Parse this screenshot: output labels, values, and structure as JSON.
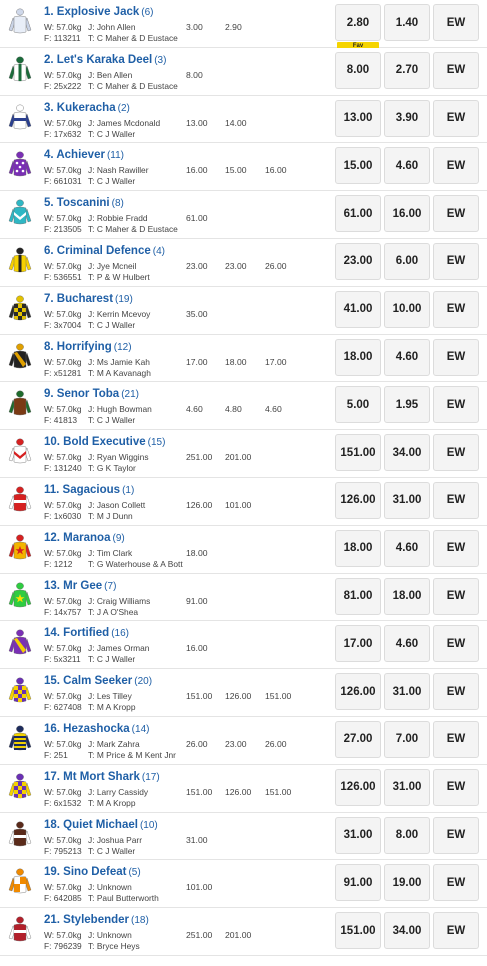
{
  "fav_label": "Fav",
  "ew_label": "EW",
  "runners": [
    {
      "no": "1",
      "name": "Explosive Jack",
      "barrier": "(6)",
      "weight": "W: 57.0kg",
      "jockey": "J: John Allen",
      "form": "F: 113211",
      "trainer": "T: C Maher & D Eustace",
      "hist": [
        "3.00",
        "2.90",
        ""
      ],
      "win": "2.80",
      "place": "1.40",
      "fav": true,
      "silk": {
        "body": "#e8eef8",
        "sleeve": "#c9d3e6",
        "cap": "#cfd8ea",
        "pattern": "none",
        "accent": "#9aa7c4"
      }
    },
    {
      "no": "2",
      "name": "Let's Karaka Deel",
      "barrier": "(3)",
      "weight": "W: 57.0kg",
      "jockey": "J: Ben Allen",
      "form": "F: 25x222",
      "trainer": "T: C Maher & D Eustace",
      "hist": [
        "8.00",
        "",
        ""
      ],
      "win": "8.00",
      "place": "2.70",
      "fav": false,
      "silk": {
        "body": "#ffffff",
        "sleeve": "#1a6b3a",
        "cap": "#1a6b3a",
        "pattern": "stripe",
        "accent": "#1a6b3a"
      }
    },
    {
      "no": "3",
      "name": "Kukeracha",
      "barrier": "(2)",
      "weight": "W: 57.0kg",
      "jockey": "J: James Mcdonald",
      "form": "F: 17x632",
      "trainer": "T: C J Waller",
      "hist": [
        "13.00",
        "14.00",
        ""
      ],
      "win": "13.00",
      "place": "3.90",
      "fav": false,
      "silk": {
        "body": "#ffffff",
        "sleeve": "#2a3f8f",
        "cap": "#ffffff",
        "pattern": "band",
        "accent": "#2a3f8f"
      }
    },
    {
      "no": "4",
      "name": "Achiever",
      "barrier": "(11)",
      "weight": "W: 57.0kg",
      "jockey": "J: Nash Rawiller",
      "form": "F: 661031",
      "trainer": "T: C J Waller",
      "hist": [
        "16.00",
        "15.00",
        "16.00"
      ],
      "win": "15.00",
      "place": "4.60",
      "fav": false,
      "silk": {
        "body": "#7a2fb5",
        "sleeve": "#7a2fb5",
        "cap": "#7a2fb5",
        "pattern": "spots",
        "accent": "#ffffff"
      }
    },
    {
      "no": "5",
      "name": "Toscanini",
      "barrier": "(8)",
      "weight": "W: 57.0kg",
      "jockey": "J: Robbie Fradd",
      "form": "F: 213505",
      "trainer": "T: C Maher & D Eustace",
      "hist": [
        "61.00",
        "",
        ""
      ],
      "win": "61.00",
      "place": "16.00",
      "fav": false,
      "silk": {
        "body": "#2fb7c4",
        "sleeve": "#2fb7c4",
        "cap": "#2fb7c4",
        "pattern": "chevron",
        "accent": "#ffffff"
      }
    },
    {
      "no": "6",
      "name": "Criminal Defence",
      "barrier": "(4)",
      "weight": "W: 57.0kg",
      "jockey": "J: Jye Mcneil",
      "form": "F: 536551",
      "trainer": "T: P & W Hulbert",
      "hist": [
        "23.00",
        "23.00",
        "26.00"
      ],
      "win": "23.00",
      "place": "6.00",
      "fav": false,
      "silk": {
        "body": "#f5d100",
        "sleeve": "#f5d100",
        "cap": "#222222",
        "pattern": "stripe",
        "accent": "#222222"
      }
    },
    {
      "no": "7",
      "name": "Bucharest",
      "barrier": "(19)",
      "weight": "W: 57.0kg",
      "jockey": "J: Kerrin Mcevoy",
      "form": "F: 3x7004",
      "trainer": "T: C J Waller",
      "hist": [
        "35.00",
        "",
        ""
      ],
      "win": "41.00",
      "place": "10.00",
      "fav": false,
      "silk": {
        "body": "#e3c200",
        "sleeve": "#2a2a2a",
        "cap": "#e3c200",
        "pattern": "check",
        "accent": "#2a2a2a"
      }
    },
    {
      "no": "8",
      "name": "Horrifying",
      "barrier": "(12)",
      "weight": "W: 57.0kg",
      "jockey": "J: Ms Jamie Kah",
      "form": "F: x51281",
      "trainer": "T: M A Kavanagh",
      "hist": [
        "17.00",
        "18.00",
        "17.00"
      ],
      "win": "18.00",
      "place": "4.60",
      "fav": false,
      "silk": {
        "body": "#222222",
        "sleeve": "#222222",
        "cap": "#e0a000",
        "pattern": "sash",
        "accent": "#e0a000"
      }
    },
    {
      "no": "9",
      "name": "Senor Toba",
      "barrier": "(21)",
      "weight": "W: 57.0kg",
      "jockey": "J: Hugh Bowman",
      "form": "F: 41813",
      "trainer": "T: C J Waller",
      "hist": [
        "4.60",
        "4.80",
        "4.60"
      ],
      "win": "5.00",
      "place": "1.95",
      "fav": false,
      "silk": {
        "body": "#7a3a14",
        "sleeve": "#1f6b2c",
        "cap": "#1f6b2c",
        "pattern": "none",
        "accent": "#1f6b2c"
      }
    },
    {
      "no": "10",
      "name": "Bold Executive",
      "barrier": "(15)",
      "weight": "W: 57.0kg",
      "jockey": "J: Ryan Wiggins",
      "form": "F: 131240",
      "trainer": "T: G K Taylor",
      "hist": [
        "251.00",
        "201.00",
        ""
      ],
      "win": "151.00",
      "place": "34.00",
      "fav": false,
      "silk": {
        "body": "#ffffff",
        "sleeve": "#ffffff",
        "cap": "#d62020",
        "pattern": "chevron",
        "accent": "#d62020"
      }
    },
    {
      "no": "11",
      "name": "Sagacious",
      "barrier": "(1)",
      "weight": "W: 57.0kg",
      "jockey": "J: Jason Collett",
      "form": "F: 1x6030",
      "trainer": "T: M J Dunn",
      "hist": [
        "126.00",
        "101.00",
        ""
      ],
      "win": "126.00",
      "place": "31.00",
      "fav": false,
      "silk": {
        "body": "#d62020",
        "sleeve": "#ffffff",
        "cap": "#d62020",
        "pattern": "band",
        "accent": "#ffffff"
      }
    },
    {
      "no": "12",
      "name": "Maranoa",
      "barrier": "(9)",
      "weight": "W: 57.0kg",
      "jockey": "J: Tim Clark",
      "form": "F: 1212",
      "trainer": "T: G Waterhouse & A Bott",
      "hist": [
        "18.00",
        "",
        ""
      ],
      "win": "18.00",
      "place": "4.60",
      "fav": false,
      "silk": {
        "body": "#f3b400",
        "sleeve": "#d62020",
        "cap": "#d62020",
        "pattern": "star",
        "accent": "#d62020"
      }
    },
    {
      "no": "13",
      "name": "Mr Gee",
      "barrier": "(7)",
      "weight": "W: 57.0kg",
      "jockey": "J: Craig Williams",
      "form": "F: 14x757",
      "trainer": "T: J A O'Shea",
      "hist": [
        "91.00",
        "",
        ""
      ],
      "win": "81.00",
      "place": "18.00",
      "fav": false,
      "silk": {
        "body": "#2ecc40",
        "sleeve": "#2ecc40",
        "cap": "#2ecc40",
        "pattern": "star",
        "accent": "#f5e000"
      }
    },
    {
      "no": "14",
      "name": "Fortified",
      "barrier": "(16)",
      "weight": "W: 57.0kg",
      "jockey": "J: James Orman",
      "form": "F: 5x3211",
      "trainer": "T: C J Waller",
      "hist": [
        "16.00",
        "",
        ""
      ],
      "win": "17.00",
      "place": "4.60",
      "fav": false,
      "silk": {
        "body": "#7a2fb5",
        "sleeve": "#7a2fb5",
        "cap": "#7a2fb5",
        "pattern": "sash",
        "accent": "#f5d100"
      }
    },
    {
      "no": "15",
      "name": "Calm Seeker",
      "barrier": "(20)",
      "weight": "W: 57.0kg",
      "jockey": "J: Les Tilley",
      "form": "F: 627408",
      "trainer": "T: M A Kropp",
      "hist": [
        "151.00",
        "126.00",
        "151.00"
      ],
      "win": "126.00",
      "place": "31.00",
      "fav": false,
      "silk": {
        "body": "#6a2fb5",
        "sleeve": "#f5d100",
        "cap": "#6a2fb5",
        "pattern": "check",
        "accent": "#f5d100"
      }
    },
    {
      "no": "16",
      "name": "Hezashocka",
      "barrier": "(14)",
      "weight": "W: 57.0kg",
      "jockey": "J: Mark Zahra",
      "form": "F: 251",
      "trainer": "T: M Price & M Kent Jnr",
      "hist": [
        "26.00",
        "23.00",
        "26.00"
      ],
      "win": "27.00",
      "place": "7.00",
      "fav": false,
      "silk": {
        "body": "#f2d200",
        "sleeve": "#1d2b5c",
        "cap": "#1d2b5c",
        "pattern": "hoops",
        "accent": "#1d2b5c"
      }
    },
    {
      "no": "17",
      "name": "Mt Mort Shark",
      "barrier": "(17)",
      "weight": "W: 57.0kg",
      "jockey": "J: Larry Cassidy",
      "form": "F: 6x1532",
      "trainer": "T: M A Kropp",
      "hist": [
        "151.00",
        "126.00",
        "151.00"
      ],
      "win": "126.00",
      "place": "31.00",
      "fav": false,
      "silk": {
        "body": "#6a2fb5",
        "sleeve": "#f5d100",
        "cap": "#6a2fb5",
        "pattern": "check",
        "accent": "#f5d100"
      }
    },
    {
      "no": "18",
      "name": "Quiet Michael",
      "barrier": "(10)",
      "weight": "W: 57.0kg",
      "jockey": "J: Joshua Parr",
      "form": "F: 795213",
      "trainer": "T: C J Waller",
      "hist": [
        "31.00",
        "",
        ""
      ],
      "win": "31.00",
      "place": "8.00",
      "fav": false,
      "silk": {
        "body": "#5a2a1a",
        "sleeve": "#ffffff",
        "cap": "#5a2a1a",
        "pattern": "band",
        "accent": "#ffffff"
      }
    },
    {
      "no": "19",
      "name": "Sino Defeat",
      "barrier": "(5)",
      "weight": "W: 57.0kg",
      "jockey": "J: Unknown",
      "form": "F: 642085",
      "trainer": "T: Paul Butterworth",
      "hist": [
        "101.00",
        "",
        ""
      ],
      "win": "91.00",
      "place": "19.00",
      "fav": false,
      "silk": {
        "body": "#ffffff",
        "sleeve": "#f08a00",
        "cap": "#f08a00",
        "pattern": "quarters",
        "accent": "#f08a00"
      }
    },
    {
      "no": "21",
      "name": "Stylebender",
      "barrier": "(18)",
      "weight": "W: 57.0kg",
      "jockey": "J: Unknown",
      "form": "F: 796239",
      "trainer": "T: Bryce Heys",
      "hist": [
        "251.00",
        "201.00",
        ""
      ],
      "win": "151.00",
      "place": "34.00",
      "fav": false,
      "silk": {
        "body": "#b21f2a",
        "sleeve": "#ffffff",
        "cap": "#b21f2a",
        "pattern": "band",
        "accent": "#ffffff"
      }
    }
  ]
}
